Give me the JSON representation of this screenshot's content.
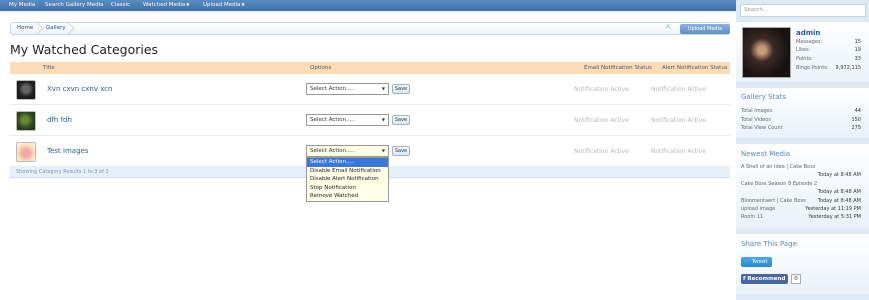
{
  "nav": {
    "items": [
      "My Media",
      "Search Gallery Media",
      "Classic",
      "Watched Media",
      "Upload Media"
    ]
  },
  "breadcrumb": {
    "items": [
      "Home",
      "Gallery"
    ]
  },
  "upload_button": "Upload Media",
  "page_title": "My Watched Categories",
  "table": {
    "headers": {
      "title": "Title",
      "options": "Options",
      "email_status": "Email Notification Status",
      "alert_status": "Alert Notification Status"
    },
    "rows": [
      {
        "name": "Xvn cxvn cxnv xcn",
        "select": "Select Action.....",
        "save": "Save",
        "email": "Notification Active",
        "alert": "Notification Active"
      },
      {
        "name": "dfh fdh",
        "select": "Select Action.....",
        "save": "Save",
        "email": "Notification Active",
        "alert": "Notification Active"
      },
      {
        "name": "Test images",
        "select": "Select Action.....",
        "save": "Save",
        "email": "Notification Active",
        "alert": "Notification Active"
      }
    ],
    "footer": "Showing Category Results 1 to 3 of 3"
  },
  "dropdown": {
    "options": [
      "Select Action.....",
      "Disable Email Notification",
      "Disable Alert Notification",
      "Stop Notification",
      "Remove Watched"
    ],
    "selected_index": 0
  },
  "sidebar": {
    "search_placeholder": "Search...",
    "user": {
      "name": "admin",
      "stats": [
        {
          "label": "Messages:",
          "value": "15"
        },
        {
          "label": "Likes:",
          "value": "19"
        },
        {
          "label": "Points:",
          "value": "33"
        },
        {
          "label": "Bingo Points:",
          "value": "9,972,115"
        }
      ]
    },
    "gallery_stats": {
      "title": "Gallery Stats",
      "items": [
        {
          "label": "Total Images",
          "value": "44"
        },
        {
          "label": "Total Videos",
          "value": "150"
        },
        {
          "label": "Total View Count",
          "value": "275"
        }
      ]
    },
    "newest_media": {
      "title": "Newest Media",
      "items": [
        {
          "title": "A Shell of an Idea | Cake Boss",
          "time": "Today at 8:48 AM"
        },
        {
          "title": "Cake Boss Season 8 Episode 2",
          "time": "Today at 8:48 AM"
        },
        {
          "title": "Bloomentaert | Cake Boss",
          "time": "Today at 8:48 AM"
        },
        {
          "title": "upload image",
          "time": "Yesterday at 11:19 PM"
        },
        {
          "title": "Room 11",
          "time": "Yesterday at 5:31 PM"
        }
      ]
    },
    "share": {
      "title": "Share This Page",
      "tweet": "Tweet",
      "recommend": "Recommend",
      "count": "0"
    }
  }
}
